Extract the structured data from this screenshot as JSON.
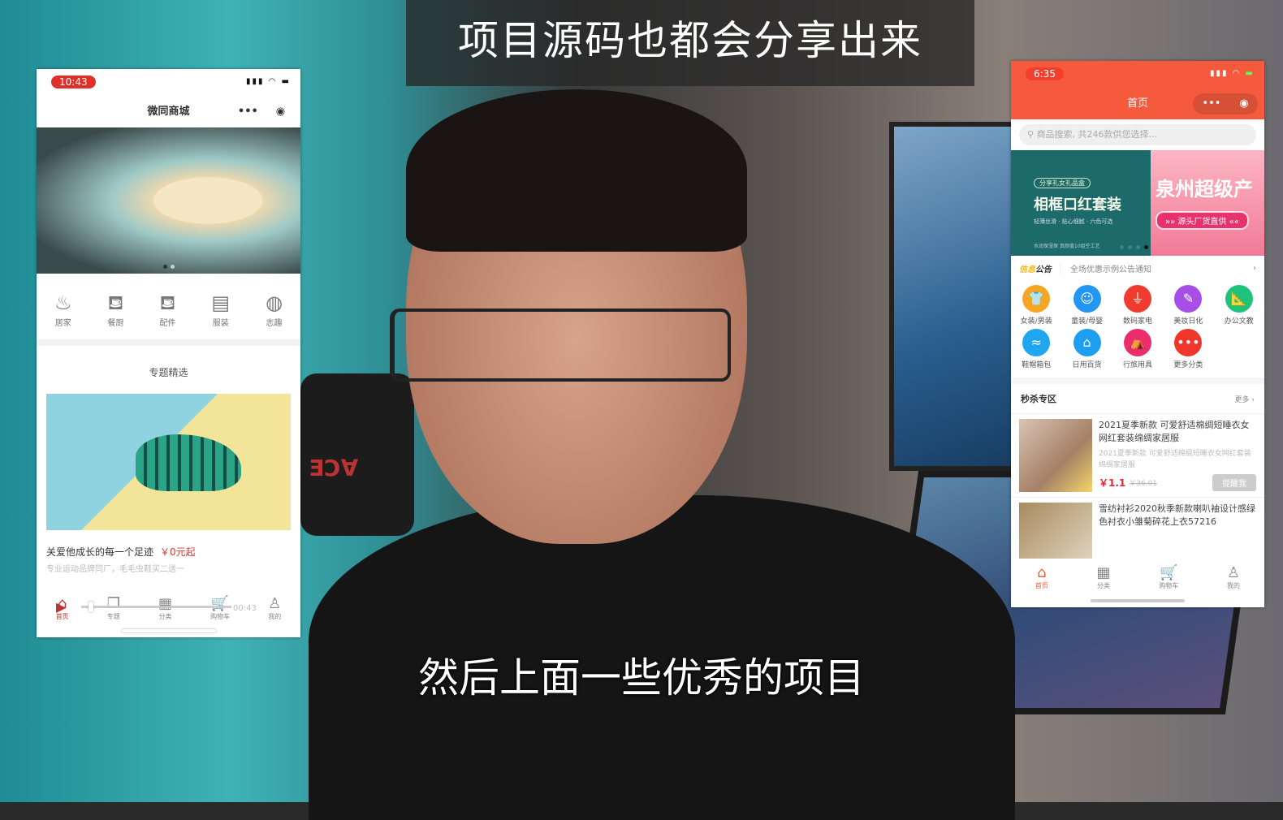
{
  "captions": {
    "top": "项目源码也都会分享出来",
    "bottom": "然后上面一些优秀的项目"
  },
  "scene": {
    "chair_logo": "ƎƆ∀"
  },
  "left_phone": {
    "time": "10:43",
    "title": "微同商城",
    "categories": [
      {
        "label": "居家",
        "icon": "pot-icon"
      },
      {
        "label": "餐厨",
        "icon": "sofa-icon"
      },
      {
        "label": "配件",
        "icon": "sofa-icon"
      },
      {
        "label": "服装",
        "icon": "box-icon"
      },
      {
        "label": "志趣",
        "icon": "planet-icon"
      }
    ],
    "section_title": "专题精选",
    "feature": {
      "title": "关爱他成长的每一个足迹",
      "price": "￥0元起",
      "subtitle": "专业运动品牌同厂，毛毛虫鞋买二送一"
    },
    "video": {
      "elapsed": "00:43",
      "progress_percent": 5
    },
    "tabs": [
      {
        "label": "首页",
        "icon": "home-icon",
        "active": true
      },
      {
        "label": "专题",
        "icon": "pages-icon"
      },
      {
        "label": "分类",
        "icon": "grid-icon"
      },
      {
        "label": "购物车",
        "icon": "cart-icon"
      },
      {
        "label": "我的",
        "icon": "user-icon"
      }
    ]
  },
  "right_phone": {
    "time": "6:35",
    "title": "首页",
    "accent": "#f55a3c",
    "search_placeholder": "商品搜索, 共246款供您选择...",
    "banner1": {
      "pill": "分享礼女礼品盒",
      "title": "相框口红套装",
      "sub": "轻薄丝滑 · 贴心细腻 · 六色可选",
      "foot": "水润保湿保 真颜值10组空工艺"
    },
    "banner2": {
      "title": "泉州超级产",
      "pill": "»» 源头厂货直供 ««"
    },
    "notice": {
      "label_a": "信息",
      "label_b": "公告",
      "text": "全场优惠示例公告通知"
    },
    "grid": [
      {
        "label": "女装/男装",
        "color": "#f5a623",
        "icon": "shirt-icon",
        "glyph": "👕"
      },
      {
        "label": "童装/母婴",
        "color": "#2196f3",
        "icon": "baby-icon",
        "glyph": "☺"
      },
      {
        "label": "数码家电",
        "color": "#f03c2e",
        "icon": "plug-icon",
        "glyph": "⏚"
      },
      {
        "label": "美妆日化",
        "color": "#a64ee6",
        "icon": "makeup-icon",
        "glyph": "✎"
      },
      {
        "label": "办公文教",
        "color": "#1fc27a",
        "icon": "ruler-icon",
        "glyph": "📐"
      },
      {
        "label": "鞋帽箱包",
        "color": "#1ea7f0",
        "icon": "shoe-icon",
        "glyph": "≈"
      },
      {
        "label": "日用百货",
        "color": "#1e9ef0",
        "icon": "basket-icon",
        "glyph": "⌂"
      },
      {
        "label": "行旅用具",
        "color": "#ec2d6b",
        "icon": "tent-icon",
        "glyph": "⛺"
      },
      {
        "label": "更多分类",
        "color": "#f0362b",
        "icon": "more-icon",
        "glyph": "•••"
      }
    ],
    "seckill": {
      "title": "秒杀专区",
      "more": "更多 ›"
    },
    "items": [
      {
        "title": "2021夏季新款 可爱舒适棉绸短睡衣女网红套装绵绸家居服",
        "desc": "2021夏季新款 可爱舒适棉绸短睡衣女网红套装绵绸家居服",
        "price": "￥1.1",
        "orig": "￥36.01",
        "button": "提醒我"
      },
      {
        "title": "雪纺衬衫2020秋季新款喇叭袖设计感绿色衬衣小雏菊碎花上衣57216"
      }
    ],
    "tabs": [
      {
        "label": "首页",
        "icon": "home-icon",
        "active": true
      },
      {
        "label": "分类",
        "icon": "grid-icon"
      },
      {
        "label": "购物车",
        "icon": "cart-icon"
      },
      {
        "label": "我的",
        "icon": "user-icon"
      }
    ]
  }
}
